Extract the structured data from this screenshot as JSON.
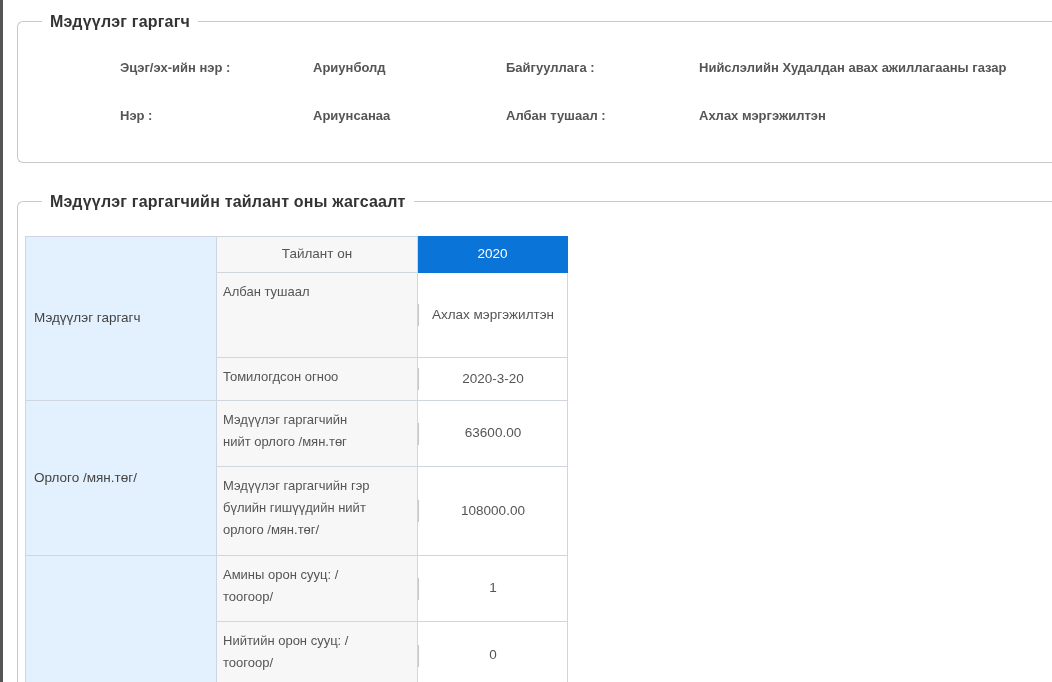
{
  "personal_section": {
    "title": "Мэдүүлэг гаргагч",
    "rows": [
      [
        {
          "label": "Эцэг/эх-ийн нэр :",
          "value": "Ариунболд"
        },
        {
          "label": "Байгууллага :",
          "value": "Нийслэлийн Худалдан авах ажиллагааны газар"
        }
      ],
      [
        {
          "label": "Нэр :",
          "value": "Ариунсанаа"
        },
        {
          "label": "Албан тушаал :",
          "value": "Ахлах мэргэжилтэн"
        }
      ]
    ]
  },
  "report_section": {
    "title": "Мэдүүлэг гаргагчийн тайлант оны жагсаалт",
    "year_header": {
      "label": "Тайлант он",
      "year": "2020"
    },
    "groups": [
      {
        "label": "Мэдүүлэг гаргагч",
        "rows": [
          {
            "label": "Албан тушаал",
            "value": "Ахлах мэргэжилтэн"
          },
          {
            "label": "Томилогдсон огноо",
            "value": "2020-3-20"
          }
        ]
      },
      {
        "label": "Орлого /мян.төг/",
        "rows": [
          {
            "label": "Мэдүүлэг гаргагчийн нийт орлого /мян.төг",
            "value": "63600.00"
          },
          {
            "label": "Мэдүүлэг гаргагчийн гэр бүлийн гишүүдийн нийт орлого /мян.төг/",
            "value": "108000.00"
          }
        ]
      },
      {
        "rows": [
          {
            "label": "Амины орон сууц: /тоогоор/",
            "value": "1"
          },
          {
            "label": "Нийтийн орон сууц: /тоогоор/",
            "value": "0"
          }
        ]
      }
    ]
  }
}
